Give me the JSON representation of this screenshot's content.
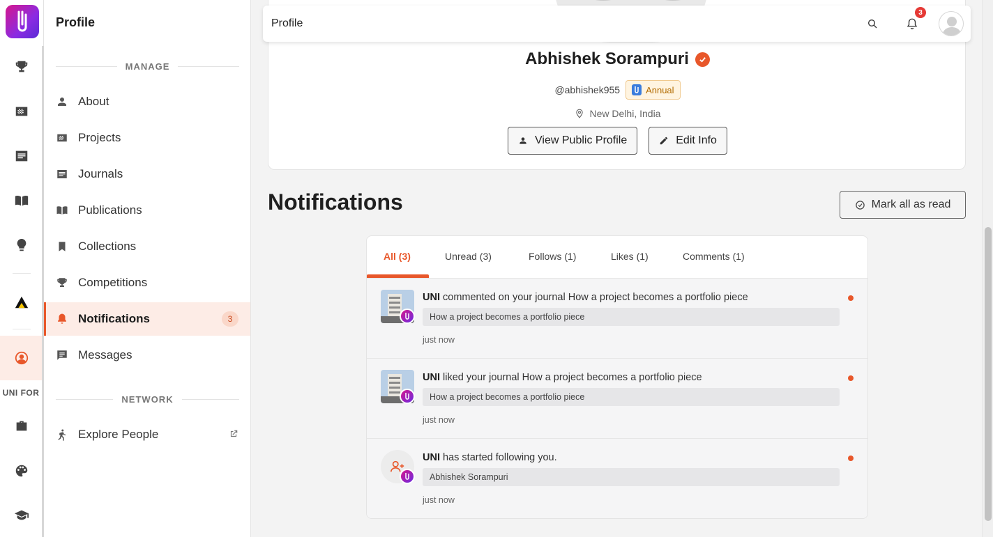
{
  "rail": {
    "label": "UNI FOR",
    "items": [
      {
        "icon": "trophy-icon"
      },
      {
        "icon": "projects-icon"
      },
      {
        "icon": "journal-icon"
      },
      {
        "icon": "book-icon"
      },
      {
        "icon": "bulb-icon"
      },
      {
        "icon": "triangle-logo-icon"
      },
      {
        "icon": "profile-circle-icon"
      },
      {
        "icon": "briefcase-icon"
      },
      {
        "icon": "palette-icon"
      },
      {
        "icon": "graduation-cap-icon"
      }
    ]
  },
  "sidebar": {
    "title": "Profile",
    "section_manage": "MANAGE",
    "section_network": "NETWORK",
    "items": [
      {
        "label": "About",
        "icon": "person-icon"
      },
      {
        "label": "Projects",
        "icon": "projects-icon"
      },
      {
        "label": "Journals",
        "icon": "journal-icon"
      },
      {
        "label": "Publications",
        "icon": "book-icon"
      },
      {
        "label": "Collections",
        "icon": "bookmark-icon"
      },
      {
        "label": "Competitions",
        "icon": "trophy-icon"
      },
      {
        "label": "Notifications",
        "icon": "bell-icon",
        "badge": "3",
        "active": true
      },
      {
        "label": "Messages",
        "icon": "message-icon"
      }
    ],
    "network_items": [
      {
        "label": "Explore People",
        "icon": "person-walking-icon"
      }
    ]
  },
  "topbar": {
    "title": "Profile",
    "notification_count": "3"
  },
  "profile": {
    "name": "Abhishek Sorampuri",
    "handle": "@abhishek955",
    "plan": "Annual",
    "location": "New Delhi, India",
    "view_public_label": "View Public Profile",
    "edit_info_label": "Edit Info"
  },
  "notifications": {
    "title": "Notifications",
    "mark_all_label": "Mark all as read",
    "tabs": [
      {
        "label": "All (3)",
        "active": true
      },
      {
        "label": "Unread (3)"
      },
      {
        "label": "Follows (1)"
      },
      {
        "label": "Likes (1)"
      },
      {
        "label": "Comments (1)"
      }
    ],
    "items": [
      {
        "actor": "UNI",
        "text": " commented on your journal How a project becomes a portfolio piece",
        "quote": "How a project becomes a portfolio piece",
        "time": "just now"
      },
      {
        "actor": "UNI",
        "text": " liked your journal How a project becomes a portfolio piece",
        "quote": "How a project becomes a portfolio piece",
        "time": "just now"
      },
      {
        "actor": "UNI",
        "text": " has started following you.",
        "quote": "Abhishek Sorampuri",
        "time": "just now"
      }
    ]
  },
  "colors": {
    "accent": "#e8572a",
    "brand_gradient_start": "#d6178c",
    "brand_gradient_end": "#5a2bd6"
  }
}
